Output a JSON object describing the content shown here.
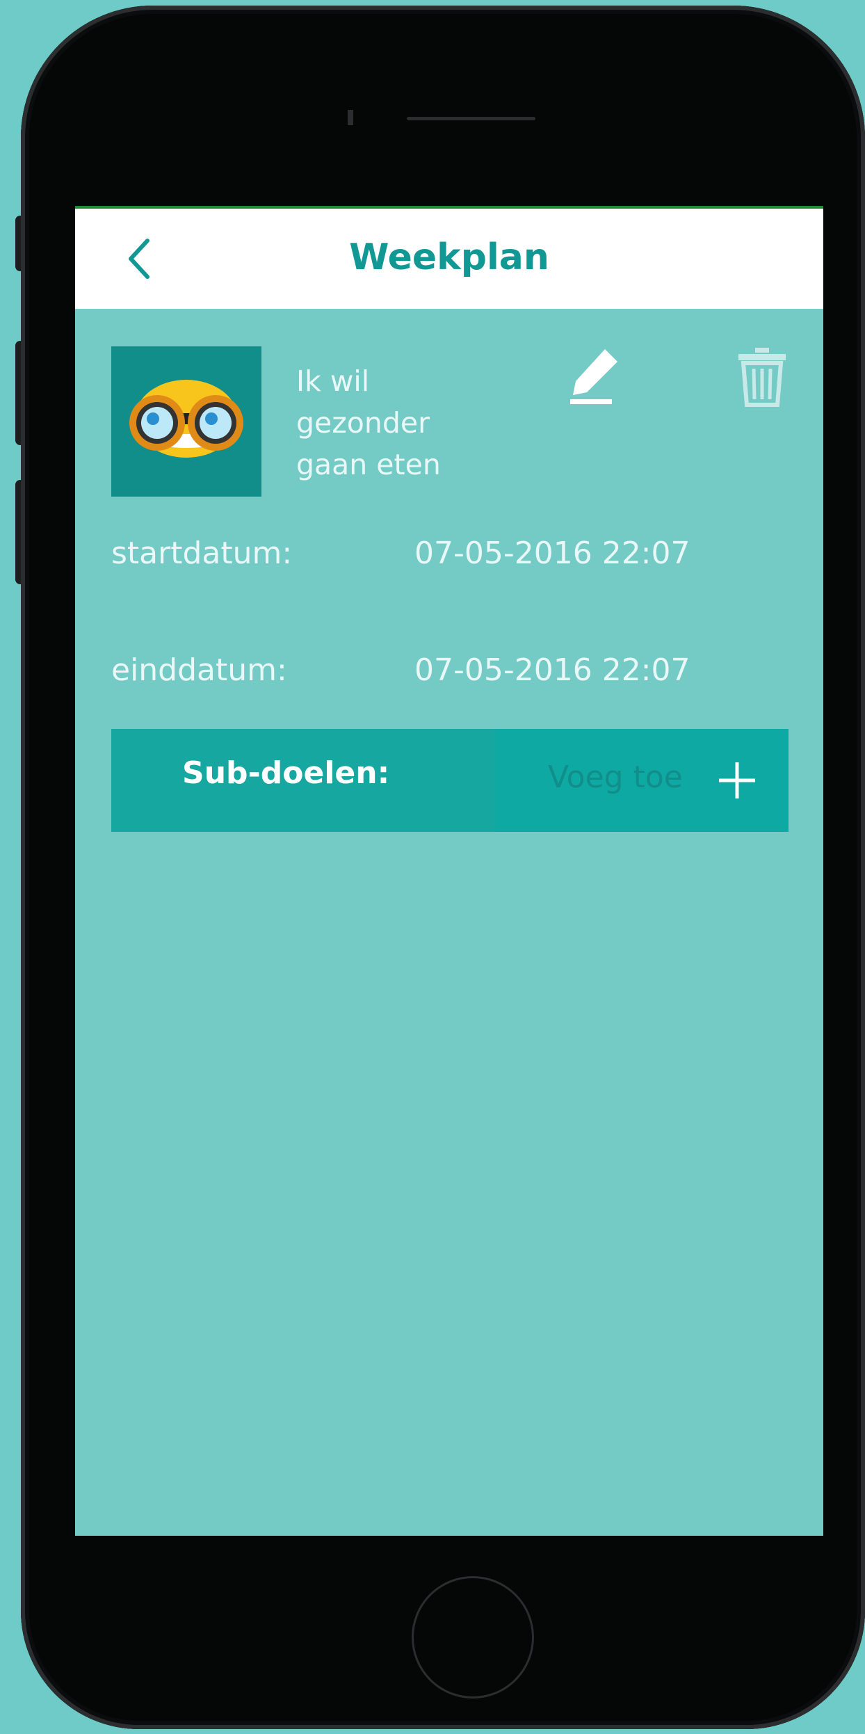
{
  "header": {
    "title": "Weekplan"
  },
  "goal": {
    "text": "Ik wil gezonder gaan eten"
  },
  "details": {
    "start_label": "startdatum:",
    "start_value": "07-05-2016 22:07",
    "end_label": "einddatum:",
    "end_value": "07-05-2016 22:07"
  },
  "subgoals": {
    "title": "Sub-doelen:",
    "add_label": "Voeg toe"
  },
  "icons": {
    "back": "chevron-left-icon",
    "edit": "pencil-icon",
    "delete": "trash-icon",
    "add": "plus-icon",
    "avatar": "binoculars-icon"
  },
  "colors": {
    "accent": "#129894",
    "screen_bg": "#74cbc6",
    "bar_dark": "#17a7a1",
    "bar_light": "#0ea9a2"
  }
}
